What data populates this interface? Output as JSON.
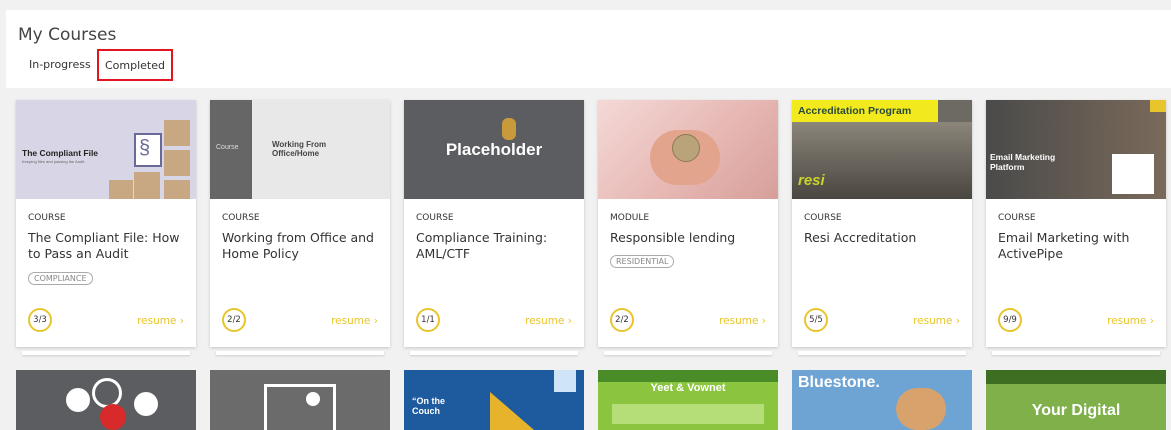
{
  "page": {
    "title": "My Courses",
    "tabs": [
      {
        "label": "In-progress"
      },
      {
        "label": "Completed"
      }
    ]
  },
  "courses": [
    {
      "type": "COURSE",
      "title": "The Compliant File: How to Pass an Audit",
      "tag": "COMPLIANCE",
      "progress": "3/3",
      "action": "resume ›",
      "thumb_text": "The Compliant File",
      "thumb_sub": "Keeping files and passing the Audit"
    },
    {
      "type": "COURSE",
      "title": "Working from Office and Home Policy",
      "tag": "",
      "progress": "2/2",
      "action": "resume ›",
      "thumb_text": "Working From Office/Home",
      "thumb_sub": "Course"
    },
    {
      "type": "COURSE",
      "title": "Compliance Training: AML/CTF",
      "tag": "",
      "progress": "1/1",
      "action": "resume ›",
      "thumb_text": "Placeholder"
    },
    {
      "type": "MODULE",
      "title": "Responsible lending",
      "tag": "RESIDENTIAL",
      "progress": "2/2",
      "action": "resume ›"
    },
    {
      "type": "COURSE",
      "title": "Resi Accreditation",
      "tag": "",
      "progress": "5/5",
      "action": "resume ›",
      "thumb_text": "Accreditation Program",
      "thumb_sub": "resi"
    },
    {
      "type": "COURSE",
      "title": "Email Marketing with ActivePipe",
      "tag": "",
      "progress": "9/9",
      "action": "resume ›",
      "thumb_text": "Email Marketing Platform"
    }
  ],
  "bottom_row": [
    {
      "thumb_text": ""
    },
    {
      "thumb_text": ""
    },
    {
      "thumb_text": "“On the Couch"
    },
    {
      "thumb_text": "Yeet & Vownet"
    },
    {
      "thumb_text": "Bluestone."
    },
    {
      "thumb_text": "Your Digital"
    }
  ],
  "colors": {
    "accent": "#e8c52c",
    "highlight": "#e2141f"
  }
}
